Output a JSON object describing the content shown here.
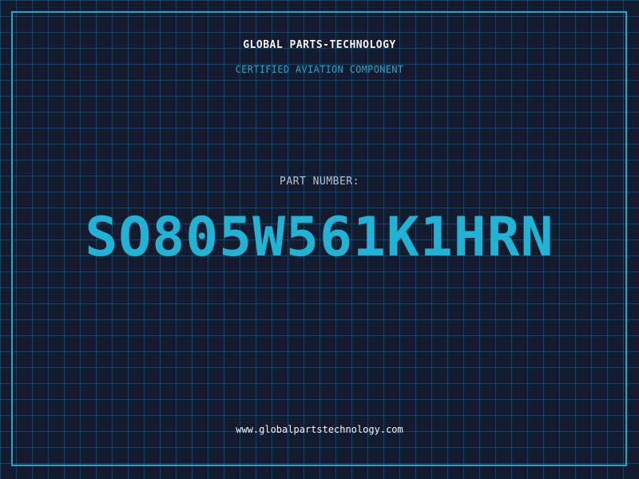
{
  "header": {
    "company_name": "GLOBAL PARTS-TECHNOLOGY",
    "subtitle": "CERTIFIED AVIATION COMPONENT"
  },
  "part": {
    "label": "PART NUMBER:",
    "number": "SO805W561K1HRN"
  },
  "footer": {
    "website": "www.globalpartstechnology.com"
  },
  "colors": {
    "background": "#141b2f",
    "grid": "#2896be",
    "accent": "#1fa6c9",
    "text": "#f2f5fa"
  }
}
